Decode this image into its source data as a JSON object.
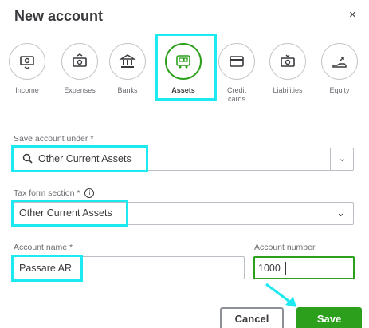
{
  "dialog": {
    "title": "New account",
    "close_symbol": "×"
  },
  "account_types": [
    {
      "label": "Income",
      "icon": "income-icon"
    },
    {
      "label": "Expenses",
      "icon": "expenses-icon"
    },
    {
      "label": "Banks",
      "icon": "bank-icon"
    },
    {
      "label": "Assets",
      "icon": "assets-icon",
      "selected": true
    },
    {
      "label": "Credit cards",
      "icon": "credit-card-icon"
    },
    {
      "label": "Liabilities",
      "icon": "liabilities-icon"
    },
    {
      "label": "Equity",
      "icon": "equity-icon"
    }
  ],
  "save_under": {
    "label": "Save account under *",
    "value": "Other Current Assets",
    "chevron": "⌄"
  },
  "tax_form": {
    "label": "Tax form section *",
    "info": "i",
    "value": "Other Current Assets",
    "chevron": "⌄"
  },
  "account_name": {
    "label": "Account name *",
    "value": "Passare AR"
  },
  "account_number": {
    "label": "Account number",
    "value": "1000"
  },
  "buttons": {
    "cancel": "Cancel",
    "save": "Save"
  },
  "colors": {
    "accent_green": "#2ca01c",
    "highlight_cyan": "#1de9f0"
  }
}
